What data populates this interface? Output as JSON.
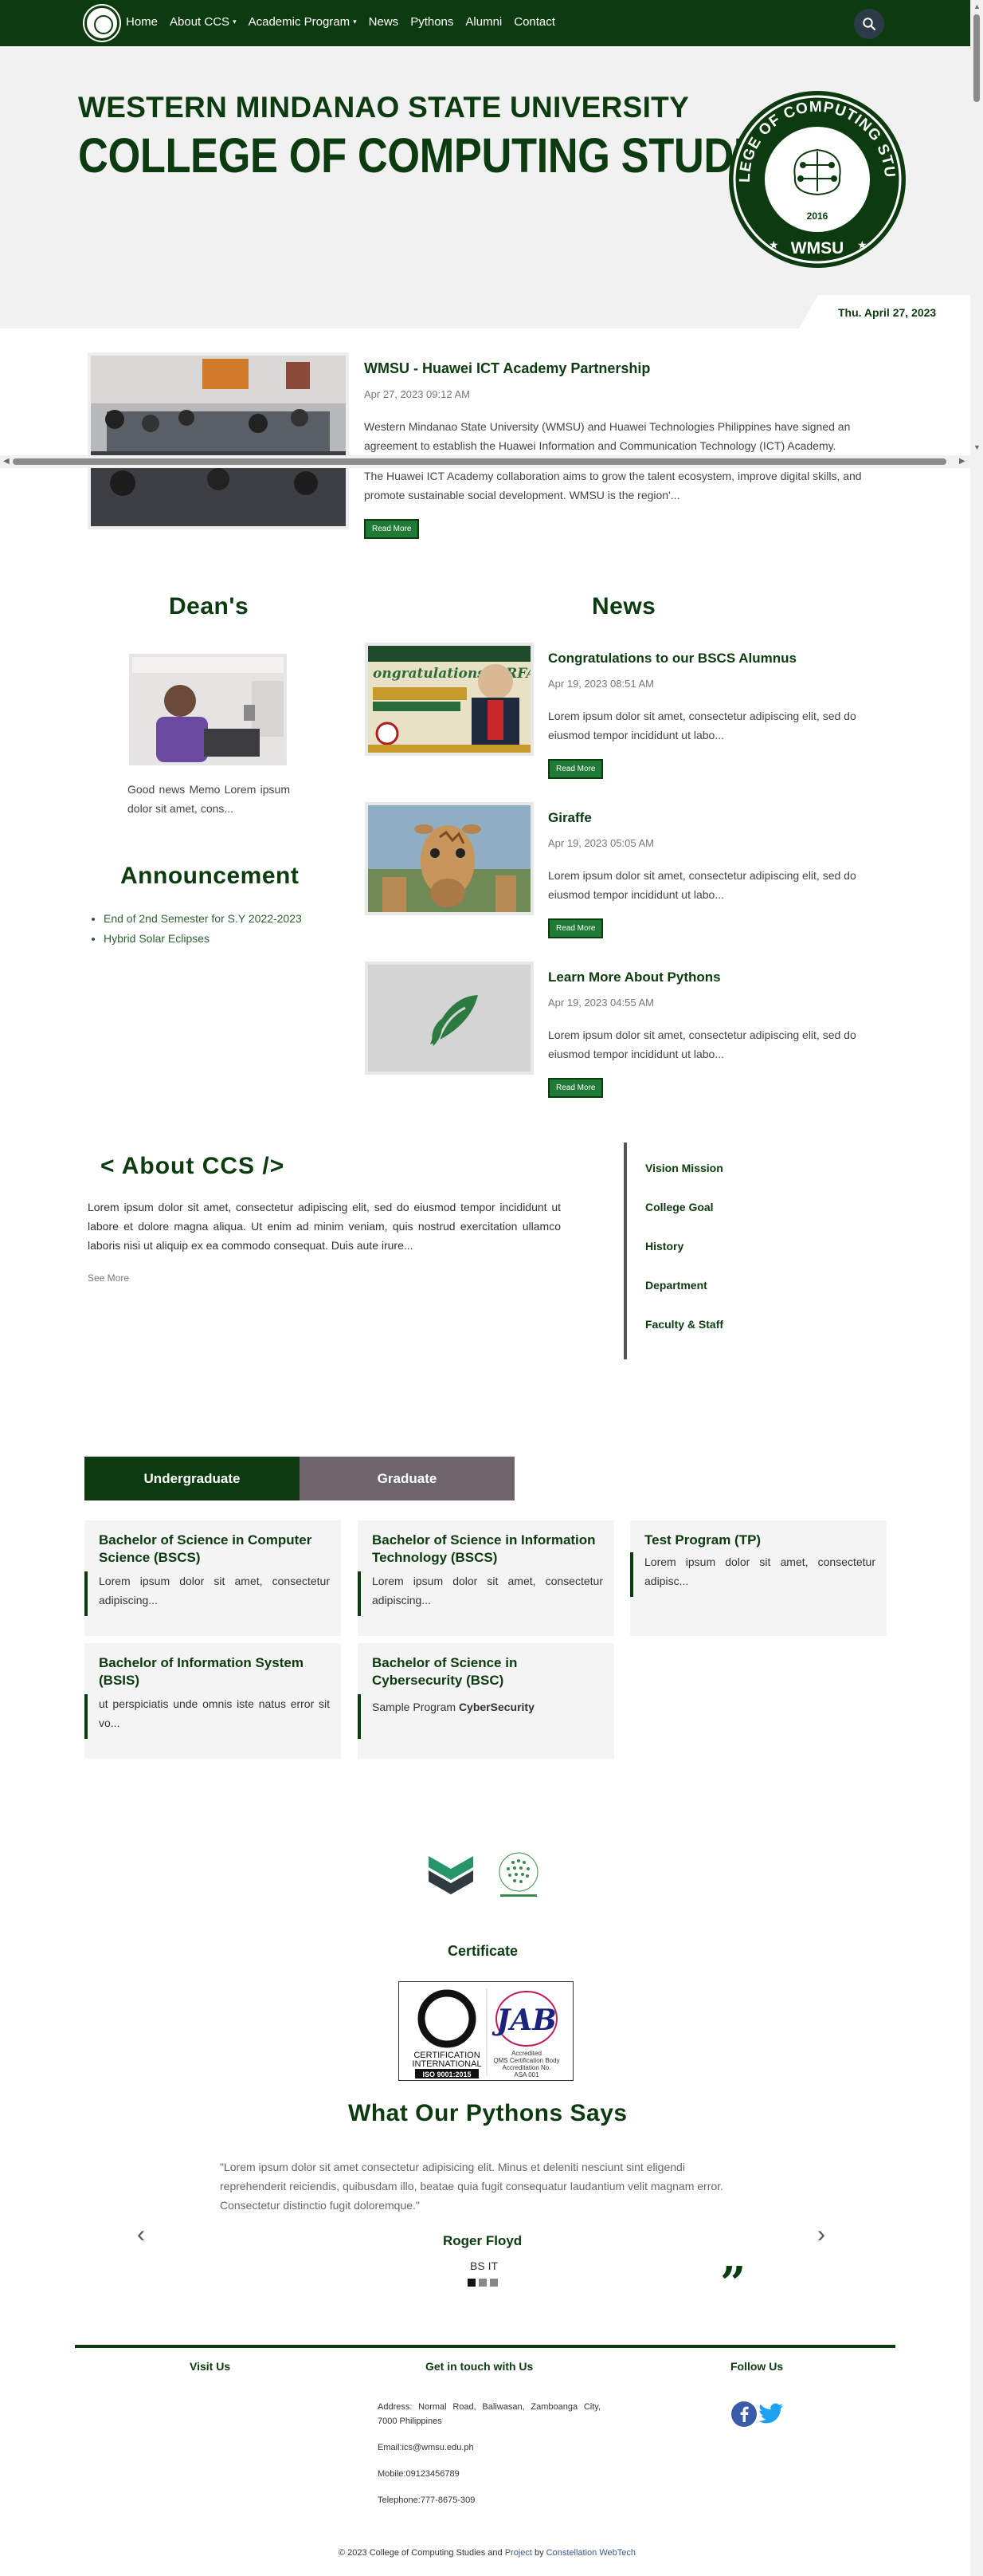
{
  "nav": {
    "links": [
      {
        "label": "Home"
      },
      {
        "label": "About CCS",
        "caret": "▾"
      },
      {
        "label": "Academic Program",
        "caret": "▾"
      },
      {
        "label": "News"
      },
      {
        "label": "Pythons"
      },
      {
        "label": "Alumni"
      },
      {
        "label": "Contact"
      }
    ]
  },
  "hero": {
    "line1": "WESTERN MINDANAO STATE UNIVERSITY",
    "line2": "COLLEGE OF COMPUTING STUDIES",
    "seal_text_top": "COLLEGE OF COMPUTING STUDIES",
    "seal_year": "2016",
    "seal_bottom": "WMSU",
    "date": "Thu. April 27, 2023"
  },
  "featured": {
    "title": "WMSU - Huawei ICT Academy Partnership",
    "date": "Apr 27, 2023 09:12 AM",
    "paragraph1": "Western Mindanao State University (WMSU) and Huawei Technologies Philippines have signed an agreement to establish the Huawei Information and Communication Technology (ICT) Academy.",
    "paragraph2": "The Huawei ICT Academy collaboration aims to grow the talent ecosystem, improve digital skills, and promote sustainable social development. WMSU is the region'...",
    "read_more": "Read More"
  },
  "dean": {
    "heading": "Dean's",
    "text": "Good news Memo Lorem ipsum dolor sit amet, cons..."
  },
  "announcement": {
    "heading": "Announcement",
    "items": [
      "End of 2nd Semester for S.Y 2022-2023",
      "Hybrid Solar Eclipses"
    ]
  },
  "news": {
    "heading": "News",
    "items": [
      {
        "title": "Congratulations to our BSCS Alumnus",
        "date": "Apr 19, 2023 08:51 AM",
        "body": "Lorem ipsum dolor sit amet, consectetur adipiscing elit, sed do eiusmod tempor incididunt ut labo...",
        "read_more": "Read More",
        "img_caption": "ongratulations! ERFAMAS OR FERMO PAC BSCS-GT ALUMNUS"
      },
      {
        "title": "Giraffe",
        "date": "Apr 19, 2023 05:05 AM",
        "body": "Lorem ipsum dolor sit amet, consectetur adipiscing elit, sed do eiusmod tempor incididunt ut labo...",
        "read_more": "Read More"
      },
      {
        "title": "Learn More About Pythons",
        "date": "Apr 19, 2023 04:55 AM",
        "body": "Lorem ipsum dolor sit amet, consectetur adipiscing elit, sed do eiusmod tempor incididunt ut labo...",
        "read_more": "Read More"
      }
    ]
  },
  "about": {
    "heading": "< About CCS />",
    "body": "Lorem ipsum dolor sit amet, consectetur adipiscing elit, sed do eiusmod tempor incididunt ut labore et dolore magna aliqua. Ut enim ad minim veniam, quis nostrud exercitation ullamco laboris nisi ut aliquip ex ea commodo consequat. Duis aute irure...",
    "see_more": "See More",
    "links": [
      "Vision Mission",
      "College Goal",
      "History",
      "Department",
      "Faculty & Staff"
    ]
  },
  "programs": {
    "tabs": {
      "undergraduate": "Undergraduate",
      "graduate": "Graduate"
    },
    "cards": [
      {
        "title": "Bachelor of Science in Computer Science (BSCS)",
        "desc": "Lorem ipsum dolor sit amet, consectetur adipiscing..."
      },
      {
        "title": "Bachelor of Science in Information Technology (BSCS)",
        "desc": "Lorem ipsum dolor sit amet, consectetur adipiscing..."
      },
      {
        "title": "Test Program (TP)",
        "desc": "Lorem ipsum dolor sit amet, consectetur adipisc..."
      },
      {
        "title": "Bachelor of Information System (BSIS)",
        "desc": "ut perspiciatis unde omnis iste natus error sit vo..."
      },
      {
        "title": "Bachelor of Science in Cybersecurity (BSC)",
        "desc_plain": "Sample Program ",
        "desc_bold": "CyberSecurity"
      }
    ]
  },
  "certificate": {
    "heading": "Certificate",
    "cert_left_line1": "CERTIFICATION",
    "cert_left_line2": "INTERNATIONAL",
    "cert_left_line3": "ISO 9001:2015",
    "cert_right_logo": "JAB",
    "cert_right_line1": "Accredited",
    "cert_right_line2": "QMS Certification Body",
    "cert_right_line3": "Accreditation No.",
    "cert_right_line4": "ASA 001"
  },
  "testimonial": {
    "heading": "What Our Pythons Says",
    "quote": "\"Lorem ipsum dolor sit amet consectetur adipisicing elit. Minus et deleniti nesciunt sint eligendi reprehenderit reiciendis, quibusdam illo, beatae quia fugit consequatur laudantium velit magnam error. Consectetur distinctio fugit doloremque.\"",
    "name": "Roger Floyd",
    "program": "BS IT",
    "prev": "‹",
    "next": "›",
    "quote_mark": "”"
  },
  "footer": {
    "visit_us": "Visit Us",
    "get_in_touch": "Get in touch with Us",
    "follow_us": "Follow Us",
    "address": "Address: Normal Road, Baliwasan, Zamboanga City, 7000 Philippines",
    "email": "Email:ics@wmsu.edu.ph",
    "mobile": "Mobile:09123456789",
    "telephone": "Telephone:777-8675-309",
    "copyright_prefix": "© 2023 College of Computing Studies and ",
    "copyright_project": "Project",
    "copyright_by": " by ",
    "copyright_team": "Constellation WebTech"
  },
  "colors": {
    "primary": "#0d3b10",
    "button": "#1e7a34",
    "graduate_tab": "#6d656b"
  }
}
